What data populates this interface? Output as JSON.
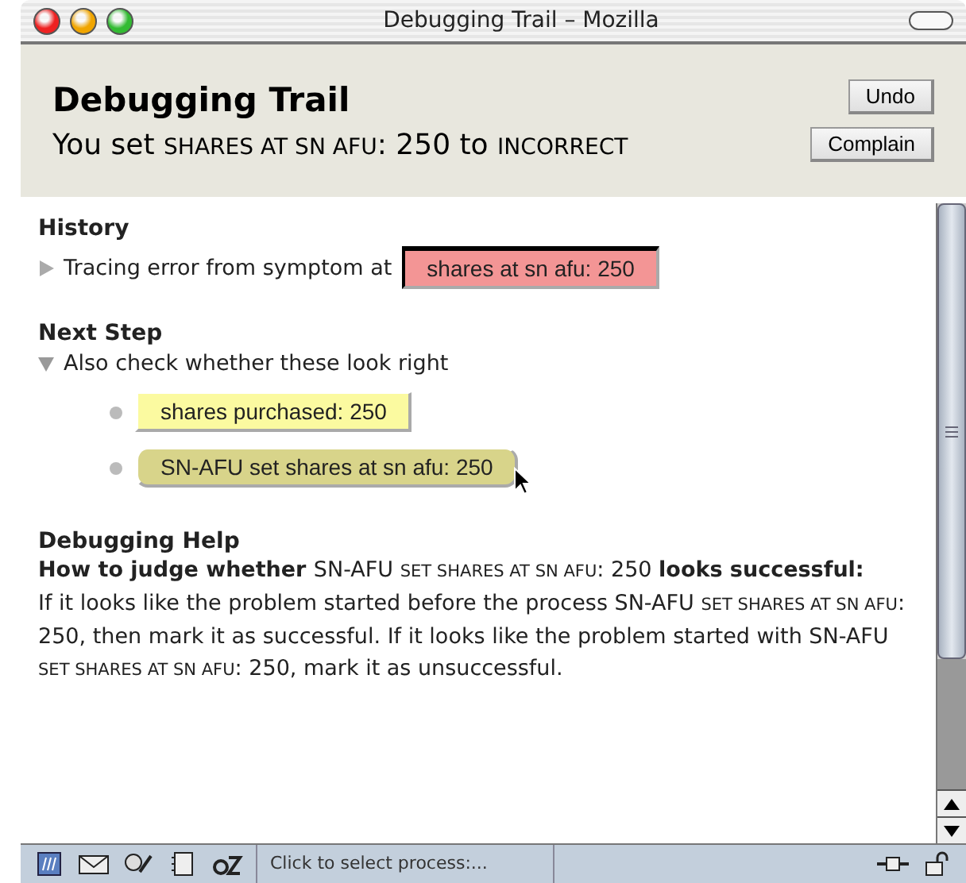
{
  "window": {
    "title": "Debugging Trail – Mozilla"
  },
  "header": {
    "title": "Debugging Trail",
    "subtitle": [
      {
        "kind": "text",
        "text": "You set "
      },
      {
        "kind": "caps",
        "text": "SHARES AT SN AFU"
      },
      {
        "kind": "text",
        "text": ": 250 to "
      },
      {
        "kind": "caps",
        "text": "INCORRECT"
      }
    ],
    "buttons": [
      "Undo",
      "Complain"
    ]
  },
  "history": {
    "heading": "History",
    "item": {
      "expanded": false,
      "text": "Tracing error from symptom at",
      "chip": {
        "kind": "symptom",
        "label": "shares at sn afu: 250"
      }
    }
  },
  "next_step": {
    "heading": "Next Step",
    "item": {
      "expanded": true,
      "text": "Also check whether these look right",
      "children": [
        {
          "kind": "plain",
          "label": "shares purchased: 250"
        },
        {
          "kind": "hover",
          "label": "SN-AFU set shares at sn afu: 250"
        }
      ]
    }
  },
  "help": {
    "heading": "Debugging Help",
    "question": [
      {
        "kind": "bold",
        "text": "How to judge whether "
      },
      {
        "kind": "text",
        "text": "SN-AFU "
      },
      {
        "kind": "caps",
        "text": "SET SHARES AT SN AFU"
      },
      {
        "kind": "text",
        "text": ": 250 "
      },
      {
        "kind": "bold",
        "text": "looks successful:"
      }
    ],
    "body": [
      {
        "kind": "text",
        "text": "If it looks like the problem started before the process SN-AFU "
      },
      {
        "kind": "caps",
        "text": "SET SHARES AT SN AFU"
      },
      {
        "kind": "text",
        "text": ": 250, then mark it as successful. If it looks like the problem started with SN-AFU "
      },
      {
        "kind": "caps",
        "text": "SET SHARES AT SN AFU"
      },
      {
        "kind": "text",
        "text": ": 250, mark it as unsuccessful."
      }
    ]
  },
  "status_bar": {
    "text": "Click to select process:..."
  }
}
